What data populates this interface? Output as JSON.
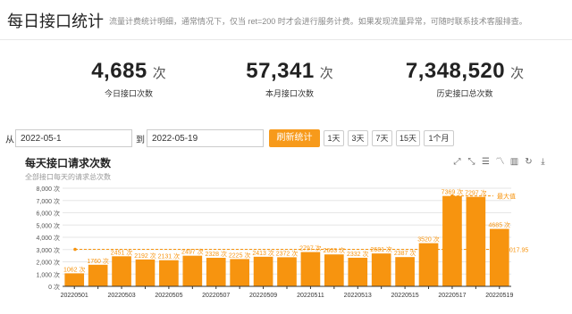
{
  "header": {
    "title": "每日接口统计",
    "subtitle": "流量计费统计明细，通常情况下，仅当 ret=200 时才会进行服务计费。如果发现流量异常，可随时联系技术客服排查。"
  },
  "stats": [
    {
      "value": "4,685",
      "unit": "次",
      "label": "今日接口次数"
    },
    {
      "value": "57,341",
      "unit": "次",
      "label": "本月接口次数"
    },
    {
      "value": "7,348,520",
      "unit": "次",
      "label": "历史接口总次数"
    }
  ],
  "filter": {
    "from_label": "从",
    "to_label": "到",
    "start_date": "2022-05-1",
    "end_date": "2022-05-19",
    "refresh_label": "刷新统计",
    "ranges": [
      "1天",
      "3天",
      "7天",
      "15天",
      "1个月"
    ]
  },
  "colors": {
    "bar": "#f7940f",
    "accent": "#f79a1b",
    "mark_line": "#f7940f"
  },
  "toolbox_icons": [
    "zoom-icon",
    "zoom-reset-icon",
    "data-view-icon",
    "line-chart-icon",
    "bar-chart-icon",
    "restore-icon",
    "save-image-icon"
  ],
  "chart_data": {
    "type": "bar",
    "title": "每天接口请求次数",
    "subtitle": "全部接口每天的请求总次数",
    "categories": [
      "20220501",
      "20220502",
      "20220503",
      "20220504",
      "20220505",
      "20220506",
      "20220507",
      "20220508",
      "20220509",
      "20220510",
      "20220511",
      "20220512",
      "20220513",
      "20220514",
      "20220515",
      "20220516",
      "20220517",
      "20220518",
      "20220519"
    ],
    "x_tick_labels": [
      "20220501",
      "20220503",
      "20220505",
      "20220507",
      "20220509",
      "20220511",
      "20220513",
      "20220515",
      "20220517",
      "20220519"
    ],
    "values": [
      1062,
      1760,
      2451,
      2192,
      2131,
      2497,
      2328,
      2225,
      2413,
      2372,
      2797,
      2603,
      2332,
      2681,
      2387,
      3520,
      7369,
      7297,
      4685
    ],
    "label_unit": " 次",
    "ylim": [
      0,
      8000
    ],
    "y_ticks": [
      0,
      1000,
      2000,
      3000,
      4000,
      5000,
      6000,
      7000,
      8000
    ],
    "y_tick_labels": [
      "0 次",
      "1,000 次",
      "2,000 次",
      "3,000 次",
      "4,000 次",
      "5,000 次",
      "6,000 次",
      "7,000 次",
      "8,000 次"
    ],
    "mark_max_label": "最大值",
    "mark_avg_label": "3017.95",
    "mark_avg_value": 3017.95,
    "grid": true
  }
}
